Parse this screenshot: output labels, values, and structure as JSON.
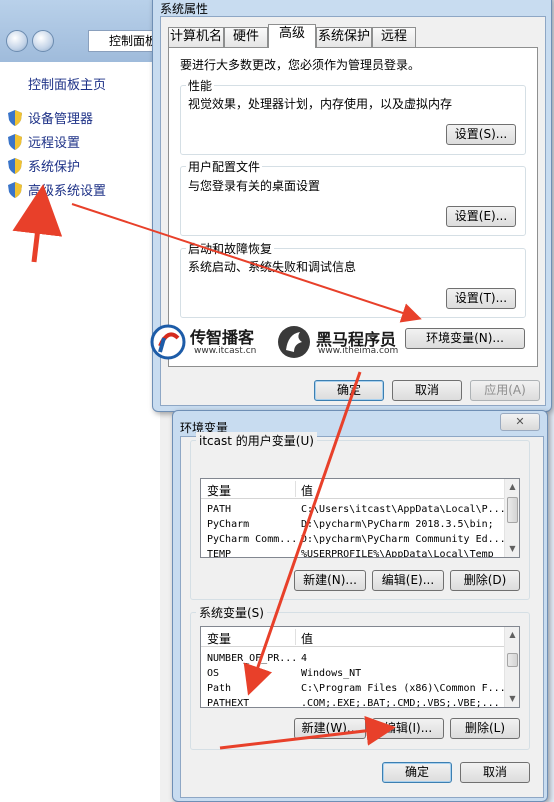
{
  "background_window": {
    "address": "控制面板",
    "home_link": "控制面板主页",
    "links": [
      "设备管理器",
      "远程设置",
      "系统保护",
      "高级系统设置"
    ]
  },
  "system_properties": {
    "title": "系统属性",
    "tabs": [
      "计算机名",
      "硬件",
      "高级",
      "系统保护",
      "远程"
    ],
    "active_tab": "高级",
    "admin_note": "要进行大多数更改，您必须作为管理员登录。",
    "performance": {
      "title": "性能",
      "desc": "视觉效果，处理器计划，内存使用，以及虚拟内存",
      "button": "设置(S)..."
    },
    "user_profiles": {
      "title": "用户配置文件",
      "desc": "与您登录有关的桌面设置",
      "button": "设置(E)..."
    },
    "startup": {
      "title": "启动和故障恢复",
      "desc": "系统启动、系统失败和调试信息",
      "button": "设置(T)..."
    },
    "env_button": "环境变量(N)...",
    "ok": "确定",
    "cancel": "取消",
    "apply": "应用(A)"
  },
  "logos": {
    "itcast": {
      "name": "传智播客",
      "url": "www.itcast.cn"
    },
    "itheima": {
      "name": "黑马程序员",
      "url": "www.itheima.com"
    }
  },
  "env_vars": {
    "title": "环境变量",
    "close": "✕",
    "user_group": "itcast 的用户变量(U)",
    "columns": {
      "var": "变量",
      "val": "值"
    },
    "user_vars": [
      {
        "name": "PATH",
        "value": "C:\\Users\\itcast\\AppData\\Local\\P..."
      },
      {
        "name": "PyCharm",
        "value": "D:\\pycharm\\PyCharm 2018.3.5\\bin;"
      },
      {
        "name": "PyCharm Comm...",
        "value": "D:\\pycharm\\PyCharm Community Ed..."
      },
      {
        "name": "TEMP",
        "value": "%USERPROFILE%\\AppData\\Local\\Temp"
      }
    ],
    "user_buttons": {
      "new": "新建(N)...",
      "edit": "编辑(E)...",
      "delete": "删除(D)"
    },
    "sys_group": "系统变量(S)",
    "sys_vars": [
      {
        "name": "NUMBER_OF_PR...",
        "value": "4"
      },
      {
        "name": "OS",
        "value": "Windows_NT"
      },
      {
        "name": "Path",
        "value": "C:\\Program Files (x86)\\Common F..."
      },
      {
        "name": "PATHEXT",
        "value": ".COM;.EXE;.BAT;.CMD;.VBS;.VBE;..."
      }
    ],
    "sys_buttons": {
      "new": "新建(W)...",
      "edit": "编辑(I)...",
      "delete": "删除(L)"
    },
    "ok": "确定",
    "cancel": "取消"
  },
  "colors": {
    "arrow": "#e8402a",
    "link": "#1e3287",
    "frame": "#c8dcf0"
  }
}
